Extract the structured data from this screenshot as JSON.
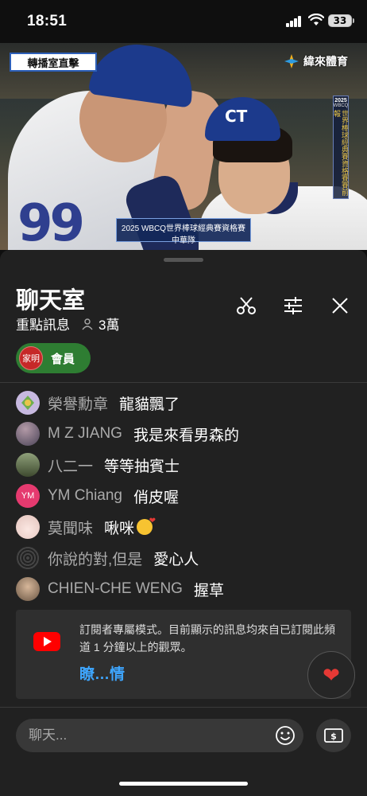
{
  "status_bar": {
    "time": "18:51",
    "battery": "33"
  },
  "video": {
    "live_tag": "轉播室直擊",
    "broadcaster": "緯來體育",
    "event_year": "2025",
    "event_sub": "WBCQ",
    "event_vertical": "世界棒球經典賽資格賽賽前報",
    "caption_title": "2025 WBCQ世界棒球經典賽資格賽",
    "caption_team": "中華隊",
    "jersey_number": "99"
  },
  "chat": {
    "title": "聊天室",
    "mode": "重點訊息",
    "viewers": "3萬",
    "member_chip": {
      "avatar_text": "家明",
      "label": "會員"
    },
    "messages": [
      {
        "author": "榮譽勳章",
        "text": "龍貓飄了",
        "avatar_color": "#c7b9e0"
      },
      {
        "author": "M Z JIANG",
        "text": "我是來看男森的",
        "avatar_color": "#7a6f86"
      },
      {
        "author": "八二一",
        "text": "等等抽賓士",
        "avatar_color": "#5b6b4a"
      },
      {
        "author": "YM Chiang",
        "text": "俏皮喔",
        "avatar_color": "#e53a6f",
        "avatar_text": "YM"
      },
      {
        "author": "莫聞味",
        "text": "啾咪",
        "avatar_color": "#f3dcd7"
      },
      {
        "author": "你說的對,但是",
        "text": "愛心人",
        "avatar_color": "#333333"
      },
      {
        "author": "CHIEN-CHE WENG",
        "text": "握草",
        "avatar_color": "#8a7a68"
      }
    ],
    "notice": {
      "text": "訂閱者專屬模式。目前顯示的訊息均來自已訂閱此頻道 1 分鐘以上的觀眾。",
      "link": "瞭…情"
    },
    "input_placeholder": "聊天..."
  }
}
